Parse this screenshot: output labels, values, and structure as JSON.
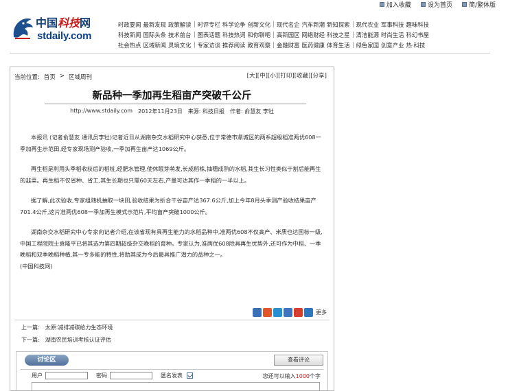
{
  "topbar": {
    "items": [
      {
        "label": "加入收藏",
        "icon": "bookmark-icon"
      },
      {
        "label": "设为首页",
        "icon": "home-icon"
      },
      {
        "label": "简/繁体版",
        "icon": "language-icon"
      }
    ]
  },
  "logo": {
    "cn_prefix": "中国",
    "cn_red": "科技",
    "cn_suffix": "网",
    "en": "stdaily.com"
  },
  "nav": {
    "rows": [
      [
        [
          "时政要闻",
          "最新发现",
          "政策解读"
        ],
        [
          "时评专栏",
          "科学论争",
          "创新文化"
        ],
        [
          "现代名企",
          "汽车新潮",
          "新知探索"
        ],
        [
          "现代农业",
          "军事科技",
          "趣味科技"
        ]
      ],
      [
        [
          "科技新闻",
          "国际头条",
          "技术前台"
        ],
        [
          "图表话题",
          "科技热词",
          "和你聊吧"
        ],
        [
          "高新园区",
          "网络财经",
          "科技之星"
        ],
        [
          "清洁能源",
          "时尚生活",
          "科幻书屋"
        ]
      ],
      [
        [
          "社会热点",
          "区域新闻",
          "灵境文化"
        ],
        [
          "专家访谈",
          "推荐阅读",
          "教育观察"
        ],
        [
          "金融财富",
          "医药健康",
          "体育生活"
        ],
        [
          "绿色家园",
          "创意产业",
          "热·科技"
        ]
      ]
    ]
  },
  "breadcrumb": {
    "prefix": "当前位置:",
    "home": "首页",
    "separator": ">",
    "section": "区域周刊"
  },
  "tools": [
    "[大]",
    "[中]",
    "[小]",
    "[打印]",
    "[收藏]",
    "[分享]"
  ],
  "article": {
    "title": "新品种一季加再生稻亩产突破千公斤",
    "url": "http://www.stdaily.com",
    "date": "2012年11月23日",
    "source_label": "来源:",
    "source": "科技日报",
    "author_label": "作者:",
    "author": "俞慧友 李牡",
    "paragraphs": [
      "本报讯 (记者俞慧友 通讯员李牡)记者近日从湖南杂交水稻研究中心获悉,位于常德市鼎城区的两系超级稻准两优608一季加再生示范田,经专家现场测产验收,一季加再生亩产达1069公斤。",
      "再生稻是利用头季稻收获后的稻桩,经肥水管理,使休眠芽萌发,长成稻株,抽穗成熟的水稻,其生长习性类似于割后能再生的韭菜。再生稻不仅省种、省工,其生长期也只需60天左右,产量可达其作一季稻的一半以上。",
      "据了解,此次验收,专家组随机抽取一块田,验收结果为折合干谷亩产达367.6公斤,加上今年8月头季测产验收结果亩产701.4公斤,这片准两优608一季加再生模式示范片,平均亩产突破1000公斤。",
      "湖南杂交水稻研究中心专家向记者介绍,在该省现有具再生能力的水稻品种中,准两优608不仅高产、米质也达国标一级,中国工程院院士袁隆平已将其选为第四期超级杂交晚稻的育种。专家认为,准两优608除具再生优势外,还可作为中稻、一季晚稻和双季晚稻种植,其一专多能的特性,将助其成为今后最具推广潜力的品种之一。"
    ],
    "source_note": "(中国科技网)"
  },
  "share": {
    "more": "更多",
    "icons": [
      "qzone-share-icon",
      "weibo-share-icon",
      "tencent-share-icon",
      "renren-share-icon",
      "kaixin-share-icon",
      "more-share-icon"
    ],
    "colors": [
      "#3b6fb6",
      "#e2562c",
      "#2a8fd0",
      "#3e74c2",
      "#d43f2f",
      "#2f76c2"
    ]
  },
  "related": {
    "prev_label": "上一篇:",
    "prev": "太原:减排减碳给力生态环境",
    "next_label": "下一篇:",
    "next": "湖南农民培训考核认证评估"
  },
  "comments": {
    "tab": "讨论区",
    "view_button": "查看评论",
    "user_label": "用户",
    "password_label": "密码",
    "anonymous_label": "匿名发表",
    "count_prefix": "您还可以输入",
    "count_value": "1000",
    "count_suffix": "个字"
  },
  "colors": {
    "brand_blue": "#0d3f87",
    "brand_red": "#c51a1a"
  }
}
